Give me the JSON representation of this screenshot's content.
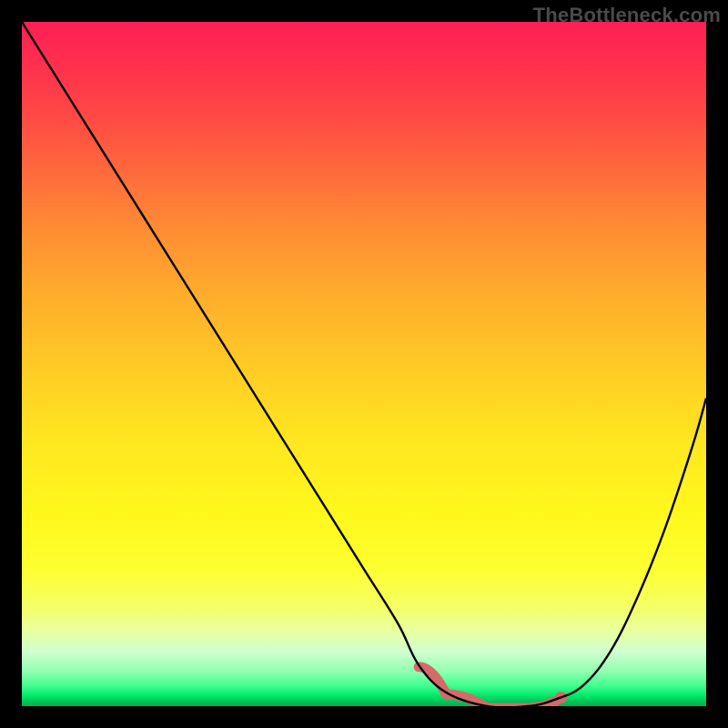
{
  "watermark": "TheBottleneck.com",
  "chart_data": {
    "type": "line",
    "title": "",
    "xlabel": "",
    "ylabel": "",
    "xlim": [
      0,
      100
    ],
    "ylim": [
      0,
      100
    ],
    "series": [
      {
        "name": "curve",
        "x": [
          0,
          5,
          10,
          15,
          20,
          25,
          30,
          35,
          40,
          45,
          50,
          55,
          58,
          62,
          68,
          74,
          78,
          82,
          86,
          90,
          94,
          98,
          100
        ],
        "values": [
          100,
          92,
          84,
          76,
          68,
          60,
          52,
          44,
          36,
          28,
          20,
          12,
          6,
          2,
          0,
          0,
          1,
          3,
          8,
          16,
          26,
          38,
          45
        ]
      }
    ],
    "annotations": [
      {
        "type": "flat_region_marker",
        "x_start": 58,
        "x_end": 78,
        "color": "#d56a6a"
      }
    ],
    "background": {
      "type": "vertical_gradient",
      "stops": [
        {
          "pos": 0.0,
          "color": "#ff1f55"
        },
        {
          "pos": 0.3,
          "color": "#ff8b34"
        },
        {
          "pos": 0.62,
          "color": "#ffe820"
        },
        {
          "pos": 0.89,
          "color": "#e9ffa0"
        },
        {
          "pos": 1.0,
          "color": "#00b050"
        }
      ]
    }
  }
}
